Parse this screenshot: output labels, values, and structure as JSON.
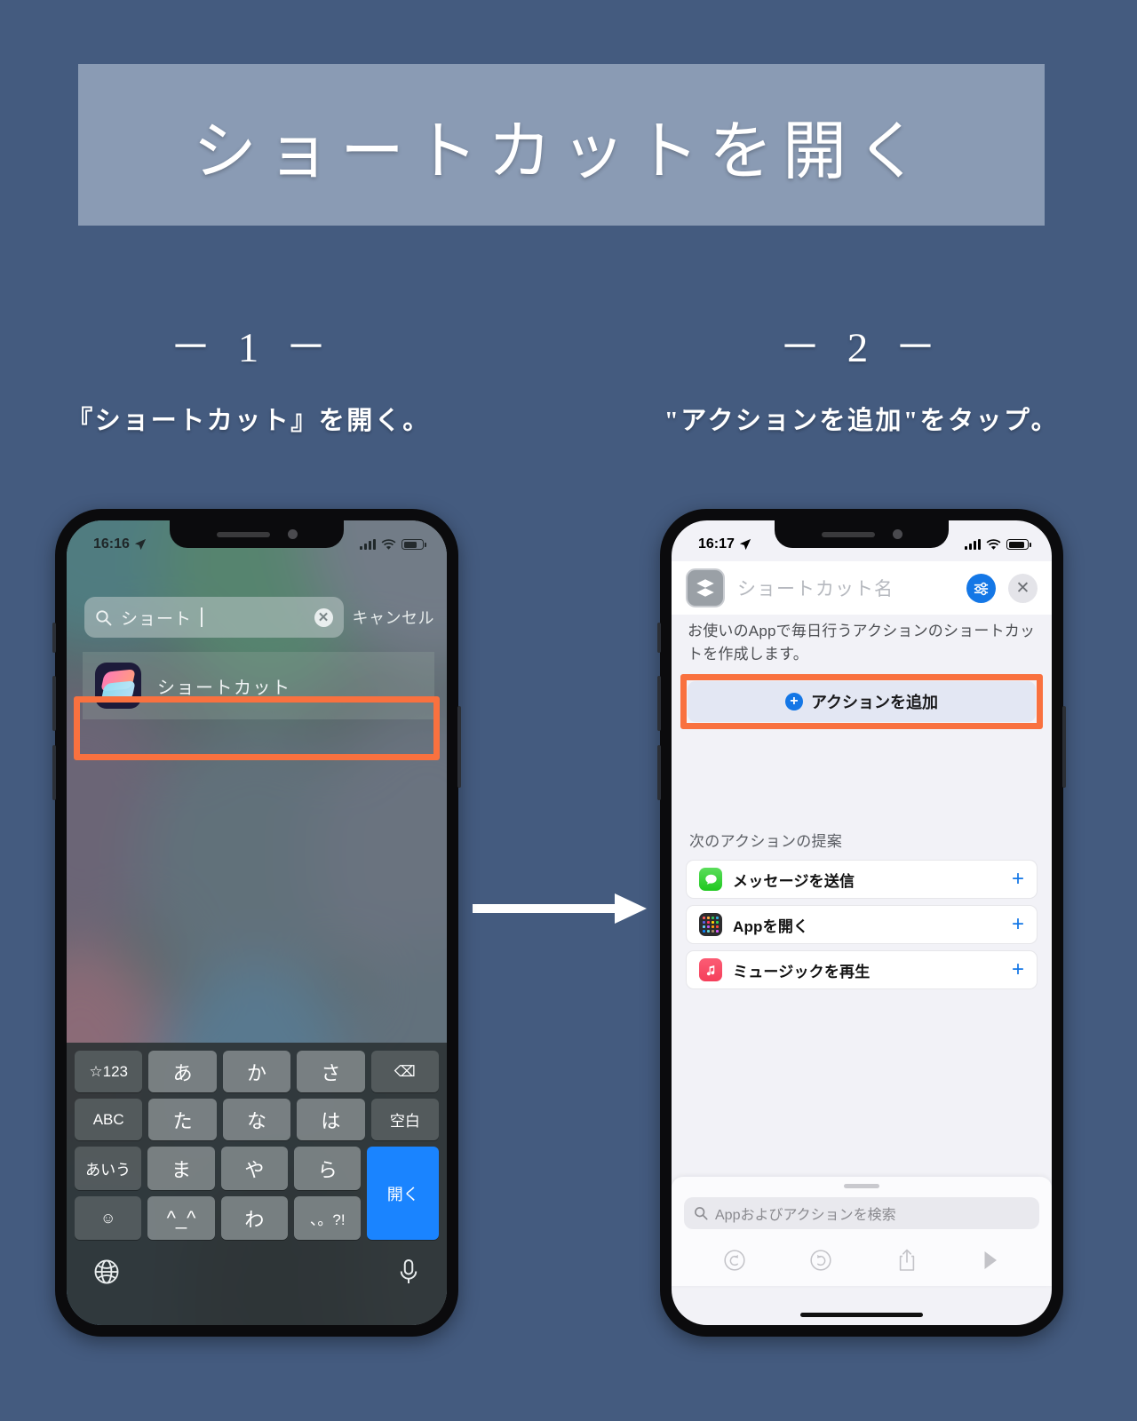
{
  "page": {
    "title": "ショートカットを開く",
    "bg_color": "#445b7f",
    "banner_color": "#8a9bb4",
    "highlight_color": "#f9713f",
    "accent_color": "#1477e6"
  },
  "steps": [
    {
      "number": "－ 1 －",
      "caption": "『ショートカット』を開く。"
    },
    {
      "number": "－ 2 －",
      "caption": "\"アクションを追加\"をタップ。"
    }
  ],
  "phone1": {
    "status": {
      "time": "16:16",
      "location_icon": "location-arrow-icon",
      "signal": "cellular-bars-icon",
      "wifi": "wifi-icon",
      "battery": "battery-icon"
    },
    "search": {
      "icon": "search-icon",
      "value": "ショート",
      "clear_icon": "clear-circle-icon",
      "cancel_label": "キャンセル"
    },
    "result": {
      "app_icon": "shortcuts-app-icon",
      "label": "ショートカット"
    },
    "keyboard": {
      "rows": [
        [
          "☆123",
          "あ",
          "か",
          "さ",
          "⌫"
        ],
        [
          "ABC",
          "た",
          "な",
          "は",
          "空白"
        ],
        [
          "あいう",
          "ま",
          "や",
          "ら",
          "開く"
        ],
        [
          "☺",
          "^_^",
          "わ",
          "、。?!"
        ]
      ],
      "globe_icon": "globe-icon",
      "mic_icon": "microphone-icon"
    }
  },
  "phone2": {
    "status": {
      "time": "16:17",
      "location_icon": "location-arrow-icon",
      "signal": "cellular-bars-icon",
      "wifi": "wifi-icon",
      "battery": "battery-icon"
    },
    "header": {
      "icon": "shortcut-layers-icon",
      "name_placeholder": "ショートカット名",
      "settings_icon": "sliders-icon",
      "close_icon": "close-icon"
    },
    "description": "お使いのAppで毎日行うアクションのショートカットを作成します。",
    "add_action": {
      "label": "アクションを追加",
      "icon": "plus-circle-icon"
    },
    "suggestions": {
      "title": "次のアクションの提案",
      "items": [
        {
          "label": "メッセージを送信",
          "icon": "messages-app-icon",
          "add": "+"
        },
        {
          "label": "Appを開く",
          "icon": "open-app-icon",
          "add": "+"
        },
        {
          "label": "ミュージックを再生",
          "icon": "music-app-icon",
          "add": "+"
        }
      ]
    },
    "sheet": {
      "search_icon": "search-icon",
      "search_placeholder": "Appおよびアクションを検索"
    },
    "toolbar": [
      {
        "icon": "undo-icon"
      },
      {
        "icon": "redo-icon"
      },
      {
        "icon": "share-icon"
      },
      {
        "icon": "play-icon"
      }
    ]
  }
}
